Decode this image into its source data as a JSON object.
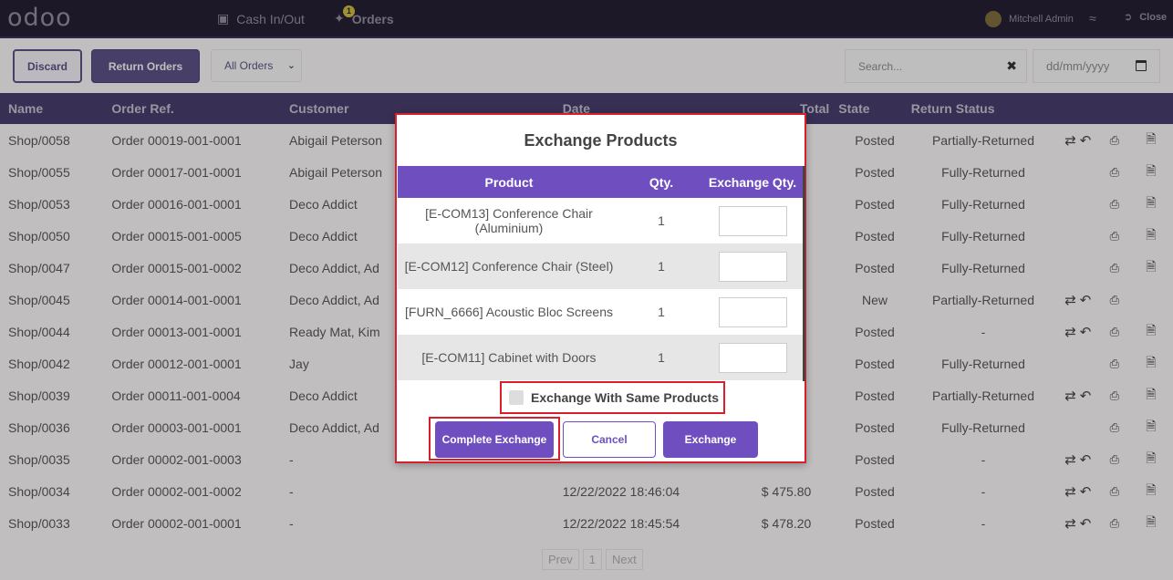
{
  "topbar": {
    "logo": "odoo",
    "cash_in_out": "Cash In/Out",
    "orders_label": "Orders",
    "orders_badge": "1",
    "user": "Mitchell Admin",
    "close": "Close"
  },
  "controls": {
    "discard": "Discard",
    "return_orders": "Return Orders",
    "filter_selected": "All Orders",
    "search_placeholder": "Search...",
    "date_placeholder": "dd/mm/yyyy"
  },
  "table": {
    "headers": [
      "Name",
      "Order Ref.",
      "Customer",
      "Date",
      "Total",
      "State",
      "Return Status"
    ],
    "rows": [
      {
        "name": "Shop/0058",
        "ref": "Order 00019-001-0001",
        "customer": "Abigail Peterson",
        "date": "",
        "total": "",
        "state": "Posted",
        "ret": "Partially-Returned",
        "exchange": true,
        "doc": true
      },
      {
        "name": "Shop/0055",
        "ref": "Order 00017-001-0001",
        "customer": "Abigail Peterson",
        "date": "",
        "total": "",
        "state": "Posted",
        "ret": "Fully-Returned",
        "exchange": false,
        "doc": true
      },
      {
        "name": "Shop/0053",
        "ref": "Order 00016-001-0001",
        "customer": "Deco Addict",
        "date": "",
        "total": "",
        "state": "Posted",
        "ret": "Fully-Returned",
        "exchange": false,
        "doc": true
      },
      {
        "name": "Shop/0050",
        "ref": "Order 00015-001-0005",
        "customer": "Deco Addict",
        "date": "",
        "total": "",
        "state": "Posted",
        "ret": "Fully-Returned",
        "exchange": false,
        "doc": true
      },
      {
        "name": "Shop/0047",
        "ref": "Order 00015-001-0002",
        "customer": "Deco Addict, Ad",
        "date": "",
        "total": "",
        "state": "Posted",
        "ret": "Fully-Returned",
        "exchange": false,
        "doc": true
      },
      {
        "name": "Shop/0045",
        "ref": "Order 00014-001-0001",
        "customer": "Deco Addict, Ad",
        "date": "",
        "total": "",
        "state": "New",
        "ret": "Partially-Returned",
        "exchange": true,
        "doc": false
      },
      {
        "name": "Shop/0044",
        "ref": "Order 00013-001-0001",
        "customer": "Ready Mat, Kim",
        "date": "",
        "total": "",
        "state": "Posted",
        "ret": "-",
        "exchange": true,
        "doc": true
      },
      {
        "name": "Shop/0042",
        "ref": "Order 00012-001-0001",
        "customer": "Jay",
        "date": "",
        "total": "",
        "state": "Posted",
        "ret": "Fully-Returned",
        "exchange": false,
        "doc": true
      },
      {
        "name": "Shop/0039",
        "ref": "Order 00011-001-0004",
        "customer": "Deco Addict",
        "date": "",
        "total": "",
        "state": "Posted",
        "ret": "Partially-Returned",
        "exchange": true,
        "doc": true
      },
      {
        "name": "Shop/0036",
        "ref": "Order 00003-001-0001",
        "customer": "Deco Addict, Ad",
        "date": "",
        "total": "",
        "state": "Posted",
        "ret": "Fully-Returned",
        "exchange": false,
        "doc": true
      },
      {
        "name": "Shop/0035",
        "ref": "Order 00002-001-0003",
        "customer": "-",
        "date": "",
        "total": "",
        "state": "Posted",
        "ret": "-",
        "exchange": true,
        "doc": true
      },
      {
        "name": "Shop/0034",
        "ref": "Order 00002-001-0002",
        "customer": "-",
        "date": "12/22/2022 18:46:04",
        "total": "$ 475.80",
        "state": "Posted",
        "ret": "-",
        "exchange": true,
        "doc": true
      },
      {
        "name": "Shop/0033",
        "ref": "Order 00002-001-0001",
        "customer": "-",
        "date": "12/22/2022 18:45:54",
        "total": "$ 478.20",
        "state": "Posted",
        "ret": "-",
        "exchange": true,
        "doc": true
      }
    ]
  },
  "pager": {
    "prev": "Prev",
    "page": "1",
    "next": "Next"
  },
  "modal": {
    "title": "Exchange Products",
    "headers": [
      "Product",
      "Qty.",
      "Exchange Qty."
    ],
    "rows": [
      {
        "product": "[E-COM13] Conference Chair (Aluminium)",
        "qty": "1"
      },
      {
        "product": "[E-COM12] Conference Chair (Steel)",
        "qty": "1"
      },
      {
        "product": "[FURN_6666] Acoustic Bloc Screens",
        "qty": "1"
      },
      {
        "product": "[E-COM11] Cabinet with Doors",
        "qty": "1"
      }
    ],
    "same_products_label": "Exchange With Same Products",
    "complete": "Complete Exchange",
    "cancel": "Cancel",
    "exchange": "Exchange"
  }
}
